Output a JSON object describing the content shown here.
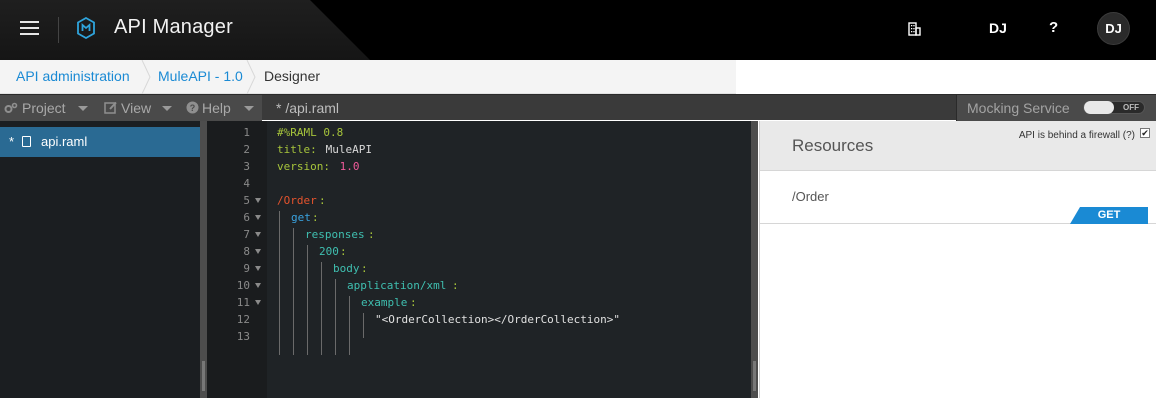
{
  "header": {
    "app_title": "API Manager",
    "org_label": "DJ",
    "help_label": "?",
    "avatar_initials": "DJ"
  },
  "breadcrumb": [
    {
      "label": "API administration"
    },
    {
      "label": "MuleAPI - 1.0"
    },
    {
      "label": "Designer"
    }
  ],
  "toolbar": {
    "project": "Project",
    "view": "View",
    "help": "Help",
    "file_tab": "* /api.raml",
    "mocking_service": "Mocking Service",
    "toggle_state": "OFF"
  },
  "sidebar": {
    "files": [
      {
        "modified": "*",
        "name": "api.raml"
      }
    ]
  },
  "editor": {
    "lines": [
      {
        "no": "1"
      },
      {
        "no": "2"
      },
      {
        "no": "3"
      },
      {
        "no": "4"
      },
      {
        "no": "5"
      },
      {
        "no": "6"
      },
      {
        "no": "7"
      },
      {
        "no": "8"
      },
      {
        "no": "9"
      },
      {
        "no": "10"
      },
      {
        "no": "11"
      },
      {
        "no": "12"
      },
      {
        "no": "13"
      }
    ],
    "code": {
      "l1": "#%RAML 0.8",
      "l2_key": "title:",
      "l2_val": " MuleAPI",
      "l3_key": "version:",
      "l3_val": " 1.0",
      "l5": "/Order",
      "l5_colon": ":",
      "l6": "get",
      "l6_colon": ":",
      "l7": "responses",
      "l7_colon": ":",
      "l8": "200",
      "l8_colon": ":",
      "l9": "body",
      "l9_colon": ":",
      "l10": "application/xml",
      "l10_colon": ":",
      "l11": "example",
      "l11_colon": ":",
      "l12": "\"<OrderCollection></OrderCollection>\""
    },
    "colors": {
      "comment": "#a6c43b",
      "key": "#a6c43b",
      "value": "#d8d8d8",
      "number": "#f05a9a",
      "resource": "#e5532d",
      "method": "#3aa3e0",
      "nested": "#3fbfb0",
      "string": "#e0e0e0"
    }
  },
  "resources_panel": {
    "title": "Resources",
    "firewall_label": "API is behind a firewall (?)",
    "firewall_checked": "✔",
    "resources": [
      {
        "path": "/Order",
        "method": "GET"
      }
    ]
  }
}
